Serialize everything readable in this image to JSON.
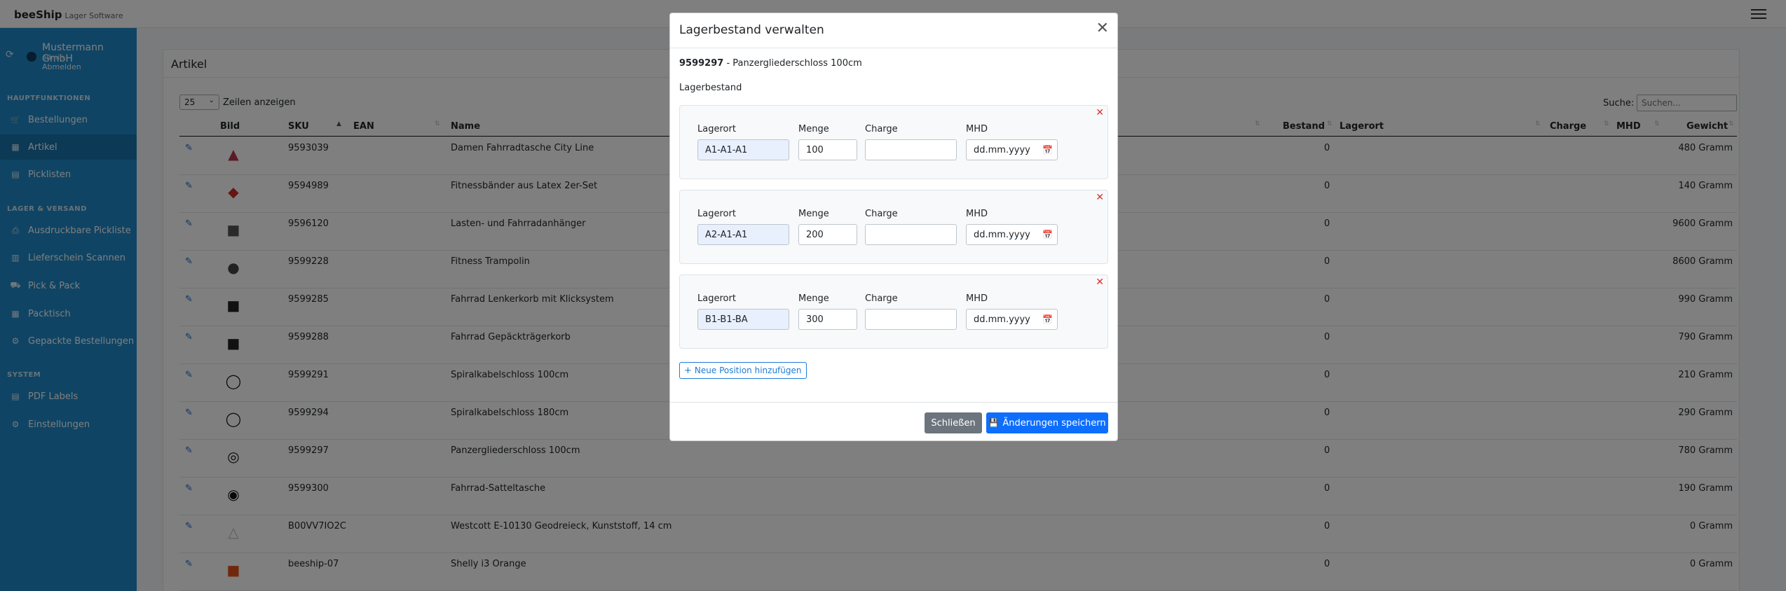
{
  "brand": {
    "name": "beeShip",
    "sub": "Lager Software"
  },
  "user": {
    "company": "Mustermann GmbH",
    "role": "admin",
    "logout": "Abmelden"
  },
  "sidebar": {
    "sections": [
      {
        "title": "HAUPTFUNKTIONEN",
        "items": [
          {
            "label": "Bestellungen",
            "icon": "cart-icon"
          },
          {
            "label": "Artikel",
            "icon": "boxes-icon",
            "active": true
          },
          {
            "label": "Picklisten",
            "icon": "file-icon"
          }
        ]
      },
      {
        "title": "LAGER & VERSAND",
        "items": [
          {
            "label": "Ausdruckbare Pickliste",
            "icon": "print-icon"
          },
          {
            "label": "Lieferschein Scannen",
            "icon": "barcode-icon"
          },
          {
            "label": "Pick & Pack",
            "icon": "truck-icon"
          },
          {
            "label": "Packtisch",
            "icon": "table-icon"
          },
          {
            "label": "Gepackte Bestellungen",
            "icon": "gear-icon"
          }
        ]
      },
      {
        "title": "SYSTEM",
        "items": [
          {
            "label": "PDF Labels",
            "icon": "pdf-icon"
          },
          {
            "label": "Einstellungen",
            "icon": "gear-icon"
          }
        ]
      }
    ]
  },
  "page": {
    "title": "Artikel",
    "length_value": "25",
    "length_label": "Zeilen anzeigen",
    "search_label": "Suche:",
    "search_placeholder": "Suchen..."
  },
  "table": {
    "headers": {
      "bild": "Bild",
      "sku": "SKU",
      "ean": "EAN",
      "name": "Name",
      "bestand": "Bestand",
      "lagerort": "Lagerort",
      "charge": "Charge",
      "mhd": "MHD",
      "gewicht": "Gewicht"
    },
    "rows": [
      {
        "sku": "9593039",
        "name": "Damen Fahrradtasche City Line",
        "bestand": "0",
        "gewicht": "480 Gramm",
        "color": "#b8334c",
        "glyph": "▲"
      },
      {
        "sku": "9594989",
        "name": "Fitnessbänder aus Latex 2er-Set",
        "bestand": "0",
        "gewicht": "140 Gramm",
        "color": "#cc2b2b",
        "glyph": "◆"
      },
      {
        "sku": "9596120",
        "name": "Lasten- und Fahrradanhänger",
        "bestand": "0",
        "gewicht": "9600 Gramm",
        "color": "#555",
        "glyph": "■"
      },
      {
        "sku": "9599228",
        "name": "Fitness Trampolin",
        "bestand": "0",
        "gewicht": "8600 Gramm",
        "color": "#444",
        "glyph": "●"
      },
      {
        "sku": "9599285",
        "name": "Fahrrad Lenkerkorb mit Klicksystem",
        "bestand": "0",
        "gewicht": "990 Gramm",
        "color": "#222",
        "glyph": "■"
      },
      {
        "sku": "9599288",
        "name": "Fahrrad Gepäckträgerkorb",
        "bestand": "0",
        "gewicht": "790 Gramm",
        "color": "#222",
        "glyph": "■"
      },
      {
        "sku": "9599291",
        "name": "Spiralkabelschloss 100cm",
        "bestand": "0",
        "gewicht": "210 Gramm",
        "color": "#111",
        "glyph": "◯"
      },
      {
        "sku": "9599294",
        "name": "Spiralkabelschloss 180cm",
        "bestand": "0",
        "gewicht": "290 Gramm",
        "color": "#111",
        "glyph": "◯"
      },
      {
        "sku": "9599297",
        "name": "Panzergliederschloss 100cm",
        "bestand": "0",
        "gewicht": "780 Gramm",
        "color": "#111",
        "glyph": "◎"
      },
      {
        "sku": "9599300",
        "name": "Fahrrad-Satteltasche",
        "bestand": "0",
        "gewicht": "190 Gramm",
        "color": "#111",
        "glyph": "◉"
      },
      {
        "sku": "B00VV7IO2C",
        "name": "Westcott E-10130 Geodreieck, Kunststoff, 14 cm",
        "bestand": "0",
        "gewicht": "0 Gramm",
        "color": "#bbb",
        "glyph": "△"
      },
      {
        "sku": "beeship-07",
        "name": "Shelly i3 Orange",
        "bestand": "0",
        "gewicht": "0 Gramm",
        "color": "#e0501b",
        "glyph": "■"
      }
    ]
  },
  "modal": {
    "title": "Lagerbestand verwalten",
    "product_sku": "9599297",
    "product_name": " - Panzergliederschloss 100cm",
    "section_title": "Lagerbestand",
    "labels": {
      "lagerort": "Lagerort",
      "menge": "Menge",
      "charge": "Charge",
      "mhd": "MHD"
    },
    "entries": [
      {
        "lagerort": "A1-A1-A1",
        "menge": "100",
        "charge": "",
        "mhd": "dd.mm.yyyy"
      },
      {
        "lagerort": "A2-A1-A1",
        "menge": "200",
        "charge": "",
        "mhd": "dd.mm.yyyy"
      },
      {
        "lagerort": "B1-B1-BA",
        "menge": "300",
        "charge": "",
        "mhd": "dd.mm.yyyy"
      }
    ],
    "add_label": "Neue Position hinzufügen",
    "close_label": "Schließen",
    "save_label": "Änderungen speichern"
  }
}
